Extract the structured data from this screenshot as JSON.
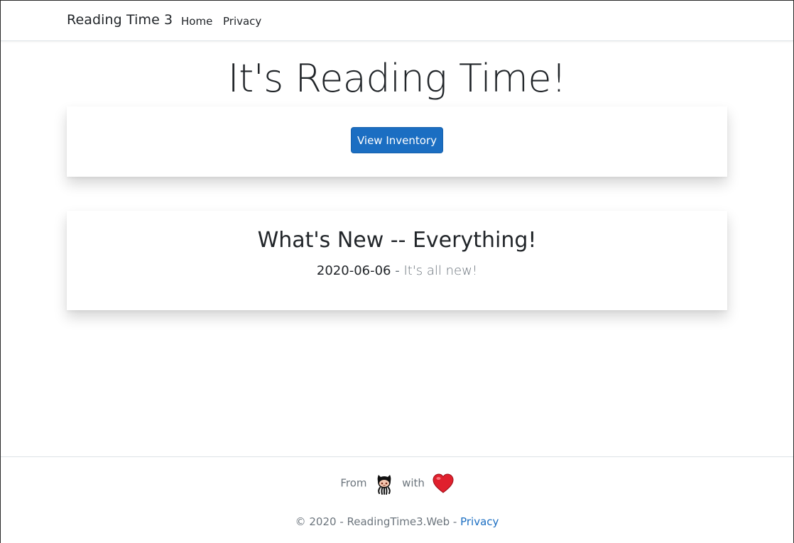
{
  "navbar": {
    "brand": "Reading Time 3",
    "links": [
      {
        "label": "Home"
      },
      {
        "label": "Privacy"
      }
    ]
  },
  "hero": {
    "title": "It's Reading Time!",
    "button_label": "View Inventory"
  },
  "news": {
    "title": "What's New -- Everything!",
    "date": "2020-06-06",
    "separator": "-",
    "text": "It's all new!"
  },
  "footer": {
    "from_label": "From",
    "with_label": "with",
    "icons": [
      "github-octocat-icon",
      "heart-icon"
    ],
    "copyright": "© 2020 - ReadingTime3.Web -",
    "privacy_link": "Privacy"
  },
  "colors": {
    "primary": "#1b6ec2",
    "muted": "#6c757d",
    "text": "#212529",
    "heart": "#e0202d"
  }
}
